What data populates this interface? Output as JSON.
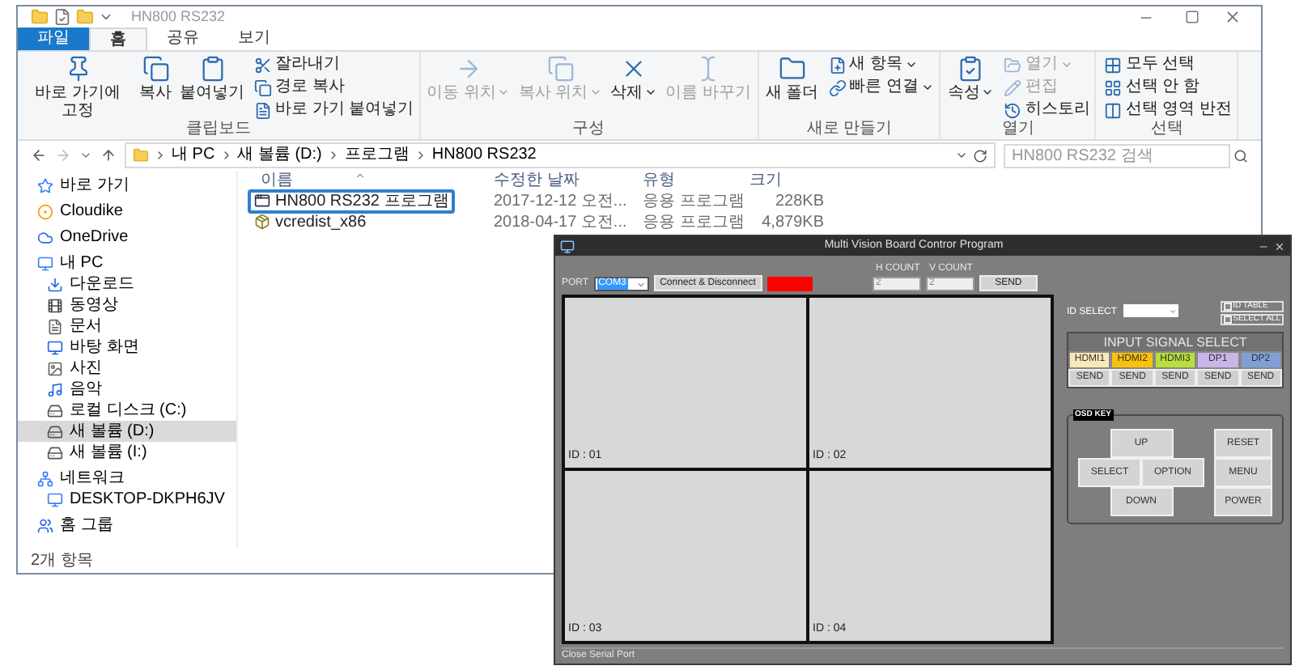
{
  "explorer": {
    "title": "HN800 RS232",
    "tabs": [
      {
        "label": "파일",
        "kind": "file",
        "selected": false
      },
      {
        "label": "홈",
        "kind": "tab",
        "selected": true
      },
      {
        "label": "공유",
        "kind": "tab",
        "selected": false
      },
      {
        "label": "보기",
        "kind": "tab",
        "selected": false
      }
    ],
    "ribbon": [
      {
        "name": "클립보드",
        "items": [
          {
            "label": "바로 가기에 고정",
            "kind": "large",
            "disabled": false,
            "dropdown": false
          },
          {
            "label": "복사",
            "kind": "large",
            "disabled": false,
            "dropdown": false
          },
          {
            "label": "붙여넣기",
            "kind": "large",
            "disabled": false,
            "dropdown": false
          },
          {
            "label": "잘라내기",
            "kind": "small",
            "disabled": false,
            "dropdown": false
          },
          {
            "label": "경로 복사",
            "kind": "small",
            "disabled": false,
            "dropdown": false
          },
          {
            "label": "바로 가기 붙여넣기",
            "kind": "small",
            "disabled": false,
            "dropdown": false
          }
        ]
      },
      {
        "name": "구성",
        "items": [
          {
            "label": "이동 위치",
            "kind": "large",
            "disabled": true,
            "dropdown": true
          },
          {
            "label": "복사 위치",
            "kind": "large",
            "disabled": true,
            "dropdown": true
          },
          {
            "label": "삭제",
            "kind": "large",
            "disabled": false,
            "dropdown": true
          },
          {
            "label": "이름 바꾸기",
            "kind": "large",
            "disabled": true,
            "dropdown": false
          }
        ]
      },
      {
        "name": "새로 만들기",
        "items": [
          {
            "label": "새 폴더",
            "kind": "large",
            "disabled": false,
            "dropdown": false
          },
          {
            "label": "새 항목",
            "kind": "small",
            "disabled": false,
            "dropdown": true
          },
          {
            "label": "빠른 연결",
            "kind": "small",
            "disabled": false,
            "dropdown": true
          }
        ]
      },
      {
        "name": "열기",
        "items": [
          {
            "label": "속성",
            "kind": "large",
            "disabled": false,
            "dropdown": true
          },
          {
            "label": "열기",
            "kind": "small",
            "disabled": true,
            "dropdown": true
          },
          {
            "label": "편집",
            "kind": "small",
            "disabled": true,
            "dropdown": false
          },
          {
            "label": "히스토리",
            "kind": "small",
            "disabled": false,
            "dropdown": false
          }
        ]
      },
      {
        "name": "선택",
        "items": [
          {
            "label": "모두 선택",
            "kind": "small",
            "disabled": false,
            "dropdown": false
          },
          {
            "label": "선택 안 함",
            "kind": "small",
            "disabled": false,
            "dropdown": false
          },
          {
            "label": "선택 영역 반전",
            "kind": "small",
            "disabled": false,
            "dropdown": false
          }
        ]
      }
    ],
    "path": [
      "내 PC",
      "새 볼륨 (D:)",
      "프로그램",
      "HN800 RS232"
    ],
    "search": {
      "placeholder": "HN800 RS232 검색"
    },
    "sidebar": [
      {
        "label": "바로 가기",
        "selected": false
      },
      {
        "label": "Cloudike",
        "selected": false
      },
      {
        "label": "OneDrive",
        "selected": false
      },
      {
        "label": "내 PC",
        "selected": false,
        "children": [
          {
            "label": "다운로드",
            "selected": false
          },
          {
            "label": "동영상",
            "selected": false
          },
          {
            "label": "문서",
            "selected": false
          },
          {
            "label": "바탕 화면",
            "selected": false
          },
          {
            "label": "사진",
            "selected": false
          },
          {
            "label": "음악",
            "selected": false
          },
          {
            "label": "로컬 디스크 (C:)",
            "selected": false
          },
          {
            "label": "새 볼륨 (D:)",
            "selected": true
          },
          {
            "label": "새 볼륨 (I:)",
            "selected": false
          }
        ]
      },
      {
        "label": "네트워크",
        "selected": false,
        "children": [
          {
            "label": "DESKTOP-DKPH6JV",
            "selected": false
          }
        ]
      },
      {
        "label": "홈 그룹",
        "selected": false
      }
    ],
    "columns": [
      "이름",
      "수정한 날짜",
      "유형",
      "크기"
    ],
    "files": [
      {
        "name": "HN800 RS232 프로그램",
        "date": "2017-12-12 오전...",
        "type": "응용 프로그램",
        "size": "228KB",
        "selected": true
      },
      {
        "name": "vcredist_x86",
        "date": "2018-04-17 오전...",
        "type": "응용 프로그램",
        "size": "4,879KB",
        "selected": false
      }
    ],
    "status": "2개 항목"
  },
  "app": {
    "title": "Multi Vision Board Contror Program",
    "port": {
      "label": "PORT",
      "value": "COM3"
    },
    "connect_button": "Connect & Disconnect",
    "connected": false,
    "h_count": {
      "label": "H COUNT",
      "value": "2"
    },
    "v_count": {
      "label": "V COUNT",
      "value": "2"
    },
    "count_send": "SEND",
    "screens": [
      "ID : 01",
      "ID : 02",
      "ID : 03",
      "ID : 04"
    ],
    "id_select": {
      "label": "ID SELECT"
    },
    "checkboxes": [
      {
        "label": "ID TABLE",
        "checked": false
      },
      {
        "label": "SELECT ALL",
        "checked": false
      }
    ],
    "input_signal": {
      "title": "INPUT SIGNAL SELECT",
      "inputs": [
        {
          "label": "HDMI1",
          "color": "#f7e9b5",
          "send": "SEND"
        },
        {
          "label": "HDMI2",
          "color": "#f9c20a",
          "send": "SEND"
        },
        {
          "label": "HDMI3",
          "color": "#b8e03a",
          "send": "SEND"
        },
        {
          "label": "DP1",
          "color": "#c9b6e8",
          "send": "SEND"
        },
        {
          "label": "DP2",
          "color": "#7f9fd6",
          "send": "SEND"
        }
      ]
    },
    "osd": {
      "title": "OSD KEY",
      "pad": [
        "UP",
        "SELECT",
        "OPTION",
        "DOWN"
      ],
      "side": [
        "RESET",
        "MENU",
        "POWER"
      ]
    },
    "status": "Close Serial Port"
  }
}
